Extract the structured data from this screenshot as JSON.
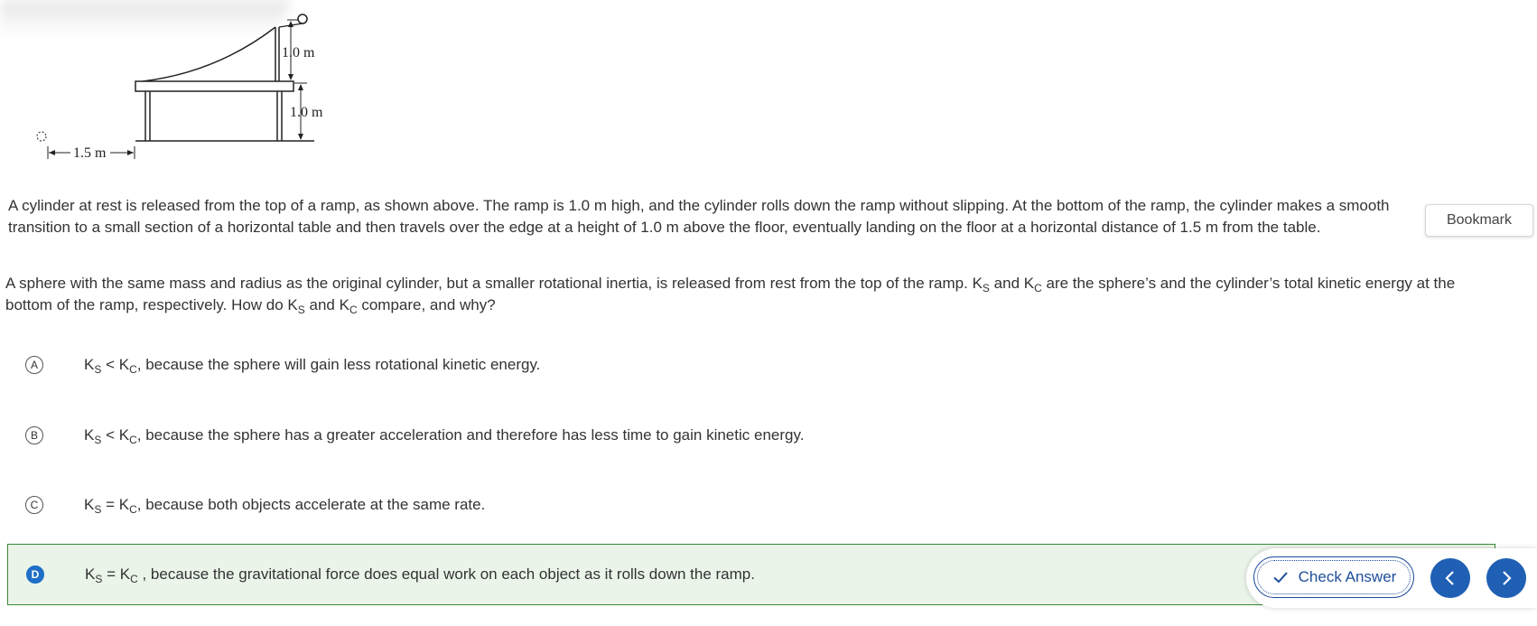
{
  "figure": {
    "label_ramp_height": "1.0 m",
    "label_table_height": "1.0 m",
    "label_distance": "1.5 m"
  },
  "intro": {
    "text": "A cylinder at rest is released from the top of a ramp, as shown above. The ramp is 1.0 m high, and the cylinder rolls down the ramp without slipping. At the bottom of the ramp, the cylinder makes a smooth transition to a small section of a horizontal table and then travels over the edge at a height of 1.0 m above the floor, eventually landing on the floor at a horizontal distance of 1.5 m from the table."
  },
  "bookmark": {
    "label": "Bookmark"
  },
  "question": {
    "part1": "A sphere with the same mass and radius as the original cylinder, but a smaller rotational inertia, is released from rest from the top of the ramp. K",
    "sub_s": "S",
    "part2": " and K",
    "sub_c": "C",
    "part3": " are the sphere’s and the cylinder’s total kinetic energy at the bottom of the ramp, respectively. How do K",
    "part4": " and K",
    "part5": " compare, and why?"
  },
  "choices": [
    {
      "letter": "A",
      "k1": "K",
      "s1": "S",
      "op": " < K",
      "s2": "C",
      "rest": ", because the sphere will gain less rotational kinetic energy."
    },
    {
      "letter": "B",
      "k1": "K",
      "s1": "S",
      "op": " < K",
      "s2": "C",
      "rest": ", because the sphere has a greater acceleration and therefore has less time to gain kinetic energy."
    },
    {
      "letter": "C",
      "k1": "K",
      "s1": "S",
      "op": " = K",
      "s2": "C",
      "rest": ", because both objects accelerate at the same rate."
    },
    {
      "letter": "D",
      "k1": "K",
      "s1": "S",
      "op": " = K",
      "s2": "C",
      "rest": " , because the gravitational force does equal work on each object as it rolls down the ramp."
    }
  ],
  "selected_choice": "D",
  "actions": {
    "check_label": "Check Answer"
  },
  "colors": {
    "accent": "#1f5fb4",
    "selected_bg": "#eaf4e9",
    "selected_border": "#3a8a3a"
  }
}
